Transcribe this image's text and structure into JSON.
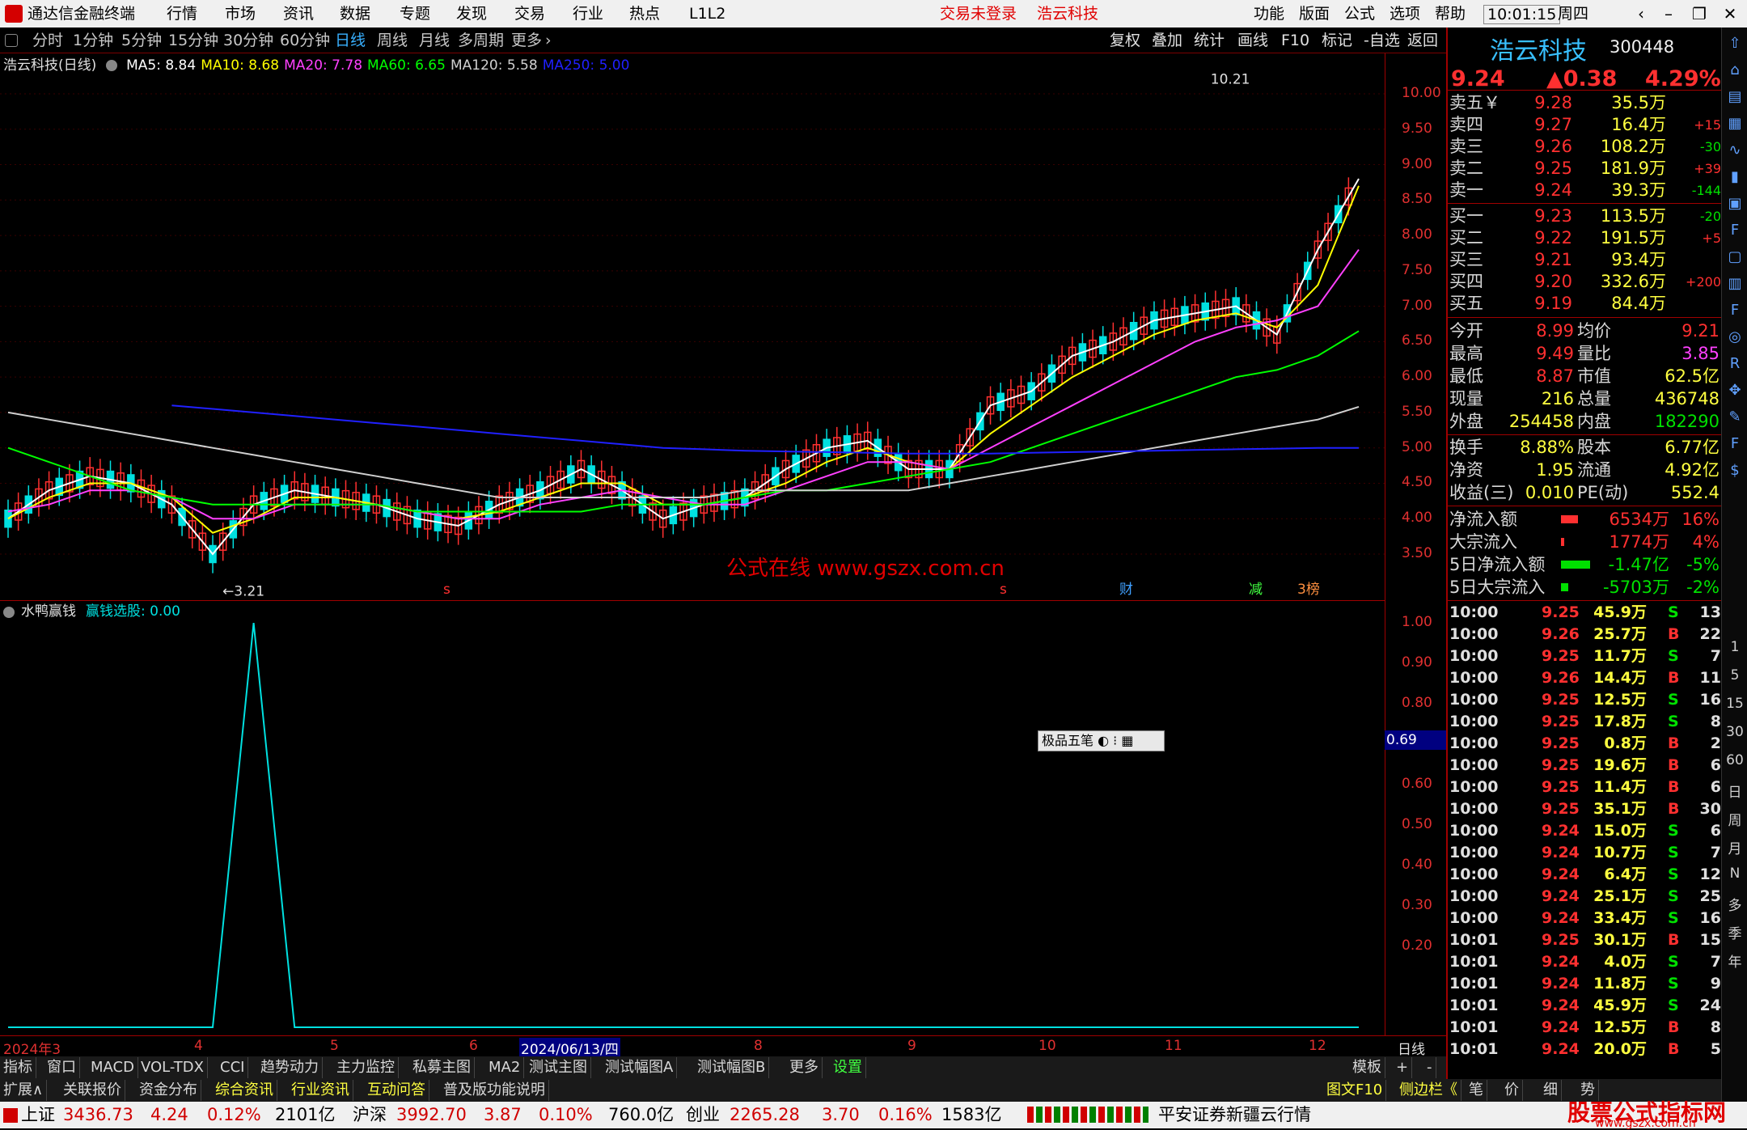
{
  "title_bar": {
    "app_name": "通达信金融终端",
    "menus": [
      "行情",
      "市场",
      "资讯",
      "数据",
      "专题",
      "发现",
      "交易",
      "行业",
      "热点",
      "L1L2"
    ],
    "login_status": "交易未登录",
    "stock_title": "浩云科技",
    "right_menus": [
      "功能",
      "版面",
      "公式",
      "选项",
      "帮助"
    ],
    "clock": "10:01:15",
    "weekday": "周四"
  },
  "period_bar": {
    "periods": [
      "分时",
      "1分钟",
      "5分钟",
      "15分钟",
      "30分钟",
      "60分钟",
      "日线",
      "周线",
      "月线",
      "多周期",
      "更多"
    ],
    "active": "日线",
    "tools": [
      "复权",
      "叠加",
      "统计",
      "画线",
      "F10",
      "标记",
      "-自选",
      "返回"
    ]
  },
  "main_chart": {
    "legend_title": "浩云科技(日线)",
    "ma": [
      {
        "label": "MA5: 8.84",
        "color": "#ffffff"
      },
      {
        "label": "MA10: 8.68",
        "color": "#ffff00"
      },
      {
        "label": "MA20: 7.78",
        "color": "#ff40ff"
      },
      {
        "label": "MA60: 6.65",
        "color": "#00ff00"
      },
      {
        "label": "MA120: 5.58",
        "color": "#d0d0d0"
      },
      {
        "label": "MA250: 5.00",
        "color": "#2020ff"
      }
    ],
    "high_label": "10.21",
    "low_label": "3.21",
    "markers": [
      {
        "text": "s",
        "color": "#ff3030"
      },
      {
        "text": "s",
        "color": "#ff3030"
      },
      {
        "text": "财",
        "color": "#40a0ff"
      },
      {
        "text": "减",
        "color": "#40ff40"
      },
      {
        "text": "3榜",
        "color": "#ff9040"
      }
    ],
    "watermark": "公式在线 www.gszx.com.cn"
  },
  "chart_data": [
    {
      "type": "line",
      "title": "浩云科技(日线)",
      "y_ticks": [
        "10.00",
        "9.50",
        "9.00",
        "8.50",
        "8.00",
        "7.50",
        "7.00",
        "6.50",
        "6.00",
        "5.50",
        "5.00",
        "4.50",
        "4.00",
        "3.50"
      ],
      "ylim": [
        3.0,
        10.5
      ],
      "x_labels": [
        "2024年3",
        "4",
        "5",
        "6",
        "2024/06/13/四",
        "8",
        "9",
        "10",
        "11",
        "12"
      ],
      "series": [
        {
          "name": "MA5",
          "values": [
            4.0,
            4.4,
            4.6,
            4.5,
            4.2,
            3.5,
            4.2,
            4.4,
            4.3,
            4.2,
            4.0,
            3.9,
            4.2,
            4.4,
            4.7,
            4.4,
            4.0,
            4.2,
            4.3,
            4.7,
            5.0,
            5.1,
            4.7,
            4.7,
            5.6,
            5.8,
            6.3,
            6.5,
            6.8,
            6.9,
            7.0,
            6.6,
            7.8,
            8.8
          ]
        },
        {
          "name": "MA10",
          "values": [
            4.0,
            4.3,
            4.5,
            4.5,
            4.3,
            3.8,
            4.0,
            4.3,
            4.3,
            4.2,
            4.1,
            4.0,
            4.1,
            4.3,
            4.5,
            4.5,
            4.2,
            4.2,
            4.3,
            4.5,
            4.8,
            5.0,
            4.8,
            4.7,
            5.2,
            5.6,
            6.0,
            6.3,
            6.6,
            6.8,
            6.9,
            6.7,
            7.3,
            8.7
          ]
        },
        {
          "name": "MA20",
          "values": [
            4.1,
            4.2,
            4.4,
            4.4,
            4.3,
            4.0,
            4.0,
            4.2,
            4.2,
            4.2,
            4.1,
            4.0,
            4.0,
            4.2,
            4.3,
            4.4,
            4.3,
            4.2,
            4.2,
            4.4,
            4.6,
            4.8,
            4.8,
            4.7,
            5.0,
            5.3,
            5.6,
            5.9,
            6.2,
            6.5,
            6.7,
            6.8,
            7.0,
            7.8
          ]
        },
        {
          "name": "MA60",
          "values": [
            5.0,
            4.8,
            4.6,
            4.4,
            4.3,
            4.2,
            4.2,
            4.2,
            4.2,
            4.2,
            4.1,
            4.1,
            4.1,
            4.1,
            4.1,
            4.2,
            4.2,
            4.2,
            4.3,
            4.4,
            4.4,
            4.5,
            4.6,
            4.7,
            4.8,
            5.0,
            5.2,
            5.4,
            5.6,
            5.8,
            6.0,
            6.1,
            6.3,
            6.65
          ]
        },
        {
          "name": "MA120",
          "values": [
            5.5,
            5.4,
            5.3,
            5.2,
            5.1,
            5.0,
            4.9,
            4.8,
            4.7,
            4.6,
            4.5,
            4.4,
            4.3,
            4.3,
            4.3,
            4.3,
            4.3,
            4.3,
            4.4,
            4.4,
            4.4,
            4.4,
            4.4,
            4.5,
            4.6,
            4.7,
            4.8,
            4.9,
            5.0,
            5.1,
            5.2,
            5.3,
            5.4,
            5.58
          ]
        },
        {
          "name": "MA250",
          "values": [
            null,
            null,
            null,
            null,
            5.6,
            5.55,
            5.5,
            5.45,
            5.4,
            5.35,
            5.3,
            5.25,
            5.2,
            5.15,
            5.1,
            5.05,
            5.0,
            4.98,
            4.96,
            4.95,
            4.94,
            4.93,
            4.92,
            4.92,
            4.92,
            4.93,
            4.94,
            4.95,
            4.96,
            4.97,
            4.98,
            4.99,
            5.0,
            5.0
          ]
        }
      ]
    },
    {
      "type": "line",
      "title": "水鸭赢钱",
      "y_ticks": [
        "1.00",
        "0.90",
        "0.80",
        "0.70",
        "0.60",
        "0.50",
        "0.40",
        "0.30",
        "0.20"
      ],
      "ylim": [
        0,
        1.05
      ],
      "series": [
        {
          "name": "赢钱选股",
          "values": [
            0,
            0,
            0,
            0,
            0,
            0,
            1.0,
            0,
            0,
            0,
            0,
            0,
            0,
            0,
            0,
            0,
            0,
            0,
            0,
            0,
            0,
            0,
            0,
            0,
            0,
            0,
            0,
            0,
            0,
            0,
            0,
            0,
            0,
            0
          ]
        }
      ]
    }
  ],
  "sub_chart": {
    "title": "水鸭赢钱",
    "indicator": "赢钱选股: 0.00",
    "current_value": "0.69",
    "ime_label": "极品五笔"
  },
  "date_axis": {
    "labels": [
      "2024年3",
      "4",
      "5",
      "6",
      "2024/06/13/四",
      "8",
      "9",
      "10",
      "11",
      "12"
    ],
    "period_label": "日线"
  },
  "tabs_row1": [
    "指标",
    "窗口",
    "MACD",
    "VOL-TDX",
    "CCI",
    "趋势动力",
    "主力监控",
    "私募主图",
    "MA2",
    "测试主图",
    "测试幅图A",
    "测试幅图B",
    "更多",
    "设置"
  ],
  "tabs_row1_right": [
    "模板",
    "+",
    "-"
  ],
  "tabs_row2": [
    "扩展∧",
    "关联报价",
    "资金分布",
    "综合资讯",
    "行业资讯",
    "互动问答",
    "普及版功能说明"
  ],
  "tabs_row2_right": [
    "图文F10",
    "侧边栏《",
    "笔",
    "价",
    "细",
    "势"
  ],
  "status_bar": {
    "sh_label": "上证",
    "sh": "3436.73",
    "sh_chg": "4.24",
    "sh_pct": "0.12%",
    "sh_amt": "2101亿",
    "sz_label": "沪深",
    "sz": "3992.70",
    "sz_chg": "3.87",
    "sz_pct": "0.10%",
    "sz_amt": "760.0亿",
    "cy_label": "创业",
    "cy": "2265.28",
    "cy_chg": "3.70",
    "cy_pct": "0.16%",
    "cy_amt": "1583亿",
    "broker": "平安证券新疆云行情",
    "brand": "股票公式指标网",
    "brand_url": "www.gszx.com.cn"
  },
  "quote": {
    "name": "浩云科技",
    "code": "300448",
    "price": "9.24",
    "change": "▲0.38",
    "pct": "4.29%",
    "asks": [
      {
        "label": "卖五￥",
        "price": "9.28",
        "vol": "35.5万",
        "chg": ""
      },
      {
        "label": "卖四",
        "price": "9.27",
        "vol": "16.4万",
        "chg": "+15"
      },
      {
        "label": "卖三",
        "price": "9.26",
        "vol": "108.2万",
        "chg": "-30"
      },
      {
        "label": "卖二",
        "price": "9.25",
        "vol": "181.9万",
        "chg": "+39"
      },
      {
        "label": "卖一",
        "price": "9.24",
        "vol": "39.3万",
        "chg": "-144"
      }
    ],
    "bids": [
      {
        "label": "买一",
        "price": "9.23",
        "vol": "113.5万",
        "chg": "-20"
      },
      {
        "label": "买二",
        "price": "9.22",
        "vol": "191.5万",
        "chg": "+5"
      },
      {
        "label": "买三",
        "price": "9.21",
        "vol": "93.4万",
        "chg": ""
      },
      {
        "label": "买四",
        "price": "9.20",
        "vol": "332.6万",
        "chg": "+200"
      },
      {
        "label": "买五",
        "price": "9.19",
        "vol": "84.4万",
        "chg": ""
      }
    ],
    "stats": [
      {
        "l1": "今开",
        "v1": "8.99",
        "l2": "均价",
        "v2": "9.21"
      },
      {
        "l1": "最高",
        "v1": "9.49",
        "l2": "量比",
        "v2": "3.85"
      },
      {
        "l1": "最低",
        "v1": "8.87",
        "l2": "市值",
        "v2": "62.5亿"
      },
      {
        "l1": "现量",
        "v1": "216",
        "l2": "总量",
        "v2": "436748"
      },
      {
        "l1": "外盘",
        "v1": "254458",
        "l2": "内盘",
        "v2": "182290"
      }
    ],
    "fund": [
      {
        "l1": "换手",
        "v1": "8.88%",
        "l2": "股本",
        "v2": "6.77亿"
      },
      {
        "l1": "净资",
        "v1": "1.95",
        "l2": "流通",
        "v2": "4.92亿"
      },
      {
        "l1": "收益(三)",
        "v1": "0.010",
        "l2": "PE(动)",
        "v2": "552.4"
      }
    ],
    "flows": [
      {
        "label": "净流入额",
        "value": "6534万",
        "pct": "16%",
        "bar_color": "#ff3030",
        "bar": 0.35
      },
      {
        "label": "大宗流入",
        "value": "1774万",
        "pct": "4%",
        "bar_color": "#ff3030",
        "bar": 0.06
      },
      {
        "label": "5日净流入额",
        "value": "-1.47亿",
        "pct": "-5%",
        "bar_color": "#00e000",
        "bar": 0.6
      },
      {
        "label": "5日大宗流入",
        "value": "-5703万",
        "pct": "-2%",
        "bar_color": "#00e000",
        "bar": 0.15
      }
    ],
    "ticks": [
      {
        "t": "10:00",
        "p": "9.25",
        "v": "45.9万",
        "s": "S",
        "n": "13"
      },
      {
        "t": "10:00",
        "p": "9.26",
        "v": "25.7万",
        "s": "B",
        "n": "22"
      },
      {
        "t": "10:00",
        "p": "9.25",
        "v": "11.7万",
        "s": "S",
        "n": "7"
      },
      {
        "t": "10:00",
        "p": "9.26",
        "v": "14.4万",
        "s": "B",
        "n": "11"
      },
      {
        "t": "10:00",
        "p": "9.25",
        "v": "12.5万",
        "s": "S",
        "n": "16"
      },
      {
        "t": "10:00",
        "p": "9.25",
        "v": "17.8万",
        "s": "S",
        "n": "8"
      },
      {
        "t": "10:00",
        "p": "9.25",
        "v": "0.8万",
        "s": "B",
        "n": "2"
      },
      {
        "t": "10:00",
        "p": "9.25",
        "v": "19.6万",
        "s": "B",
        "n": "6"
      },
      {
        "t": "10:00",
        "p": "9.25",
        "v": "11.4万",
        "s": "B",
        "n": "6"
      },
      {
        "t": "10:00",
        "p": "9.25",
        "v": "35.1万",
        "s": "B",
        "n": "30"
      },
      {
        "t": "10:00",
        "p": "9.24",
        "v": "15.0万",
        "s": "S",
        "n": "6"
      },
      {
        "t": "10:00",
        "p": "9.24",
        "v": "10.7万",
        "s": "S",
        "n": "7"
      },
      {
        "t": "10:00",
        "p": "9.24",
        "v": "6.4万",
        "s": "S",
        "n": "12"
      },
      {
        "t": "10:00",
        "p": "9.24",
        "v": "25.1万",
        "s": "S",
        "n": "25"
      },
      {
        "t": "10:00",
        "p": "9.24",
        "v": "33.4万",
        "s": "S",
        "n": "16"
      },
      {
        "t": "10:01",
        "p": "9.25",
        "v": "30.1万",
        "s": "B",
        "n": "15"
      },
      {
        "t": "10:01",
        "p": "9.24",
        "v": "4.0万",
        "s": "S",
        "n": "7"
      },
      {
        "t": "10:01",
        "p": "9.24",
        "v": "11.8万",
        "s": "S",
        "n": "9"
      },
      {
        "t": "10:01",
        "p": "9.24",
        "v": "45.9万",
        "s": "S",
        "n": "24"
      },
      {
        "t": "10:01",
        "p": "9.24",
        "v": "12.5万",
        "s": "B",
        "n": "8"
      },
      {
        "t": "10:01",
        "p": "9.24",
        "v": "20.0万",
        "s": "B",
        "n": "5"
      }
    ]
  },
  "sidebar": {
    "icons": [
      "up-icon",
      "home-icon",
      "list-icon",
      "grid-icon",
      "chart-icon",
      "candle-icon",
      "news-icon",
      "f10-icon",
      "note-icon",
      "doc-icon",
      "fs-icon",
      "circle-icon",
      "rsi-icon",
      "move-icon",
      "pen-icon",
      "fs2-icon",
      "money-icon"
    ],
    "texts": [
      "1",
      "5",
      "15",
      "30",
      "60",
      "日",
      "周",
      "月",
      "N",
      "多",
      "季",
      "年"
    ]
  }
}
